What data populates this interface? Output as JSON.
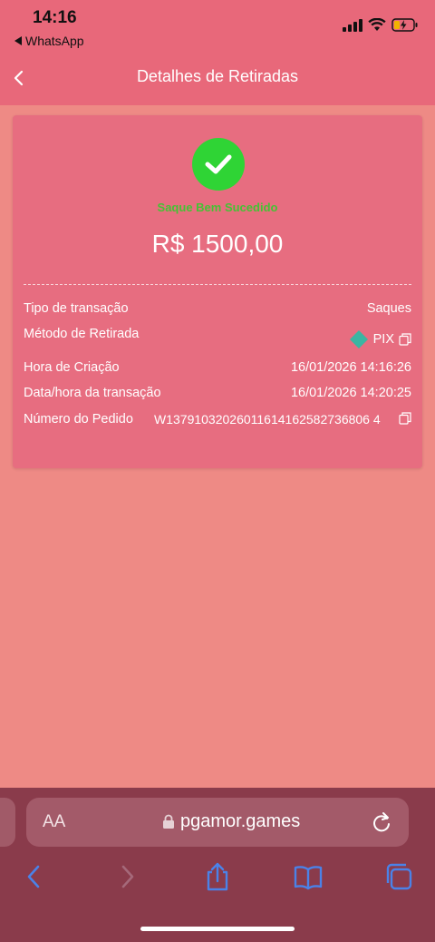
{
  "status_bar": {
    "time": "14:16",
    "back_app": "WhatsApp"
  },
  "header": {
    "title": "Detalhes de Retiradas"
  },
  "card": {
    "status": "Saque Bem Sucedido",
    "amount": "R$ 1500,00",
    "rows": [
      {
        "label": "Tipo de transação",
        "value": "Saques"
      },
      {
        "label": "Método de Retirada",
        "value": "PIX"
      },
      {
        "label": "Hora de Criação",
        "value": "16/01/2026 14:16:26"
      },
      {
        "label": "Data/hora da transação",
        "value": "16/01/2026 14:20:25"
      },
      {
        "label": "Número do Pedido",
        "value": "W13791032026011614162582736806 4"
      }
    ]
  },
  "browser": {
    "aa_label": "AA",
    "url": "pgamor.games"
  },
  "colors": {
    "header_bg": "#e8687a",
    "page_bg": "#ee8a85",
    "success_green": "#2fd435",
    "browser_bg": "#8a3b4b"
  }
}
